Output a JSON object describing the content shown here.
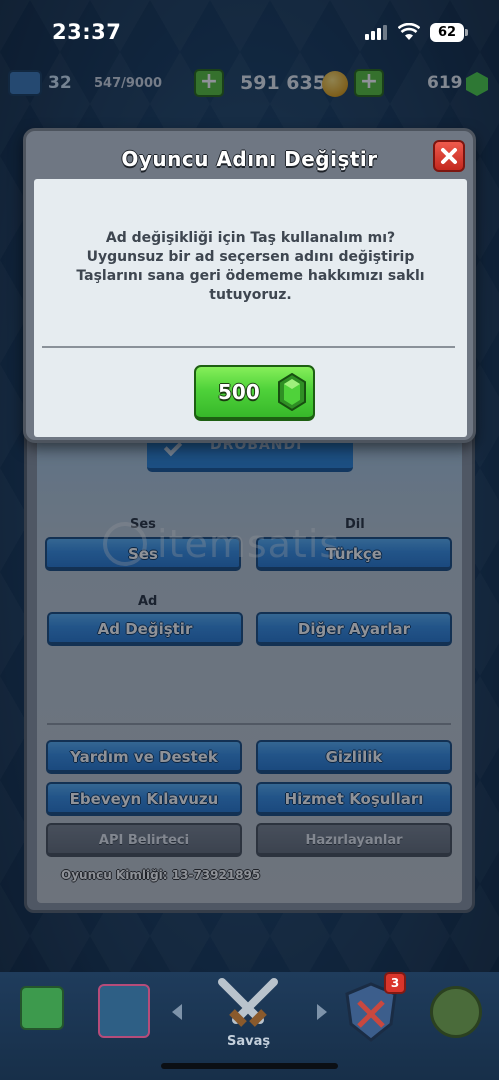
{
  "status_bar": {
    "time": "23:37",
    "battery": "62"
  },
  "resources": {
    "level": "32",
    "xp": "547/9000",
    "gold": "591 635",
    "gems": "619"
  },
  "modal": {
    "title": "Oyuncu Adını Değiştir",
    "message_lines": [
      "Ad değişikliği için Taş kullanalım mı?",
      "Uygunsuz bir ad seçersen adını değiştirip",
      "Taşlarını sana geri ödememe hakkımızı saklı",
      "tutuyoruz."
    ],
    "gem_cost": "500",
    "colors": {
      "confirm": "#4fd23a",
      "close": "#d9352b"
    }
  },
  "settings": {
    "sound_label": "Ses",
    "sound_button": "Ses",
    "language_label": "Dil",
    "language_button": "Türkçe",
    "name_label": "Ad",
    "change_name_button": "Ad Değiştir",
    "other_settings_button": "Diğer Ayarlar",
    "help_button": "Yardım ve Destek",
    "privacy_button": "Gizlilik",
    "parent_guide_button": "Ebeveyn Kılavuzu",
    "terms_button": "Hizmet Koşulları",
    "api_token_button": "API Belirteci",
    "credits_button": "Hazırlayanlar",
    "player_id": "Oyuncu Kimliği: 13-73921895",
    "colors": {
      "primary_button": "#3a8fe3",
      "secondary_button": "#68707b"
    }
  },
  "watermark": {
    "text": "itemsatis"
  },
  "bottom_nav": {
    "active_label": "Savaş",
    "notification_count": "3",
    "icons": [
      "shop-icon",
      "cards-icon",
      "battle-icon",
      "clan-icon",
      "events-icon"
    ]
  }
}
